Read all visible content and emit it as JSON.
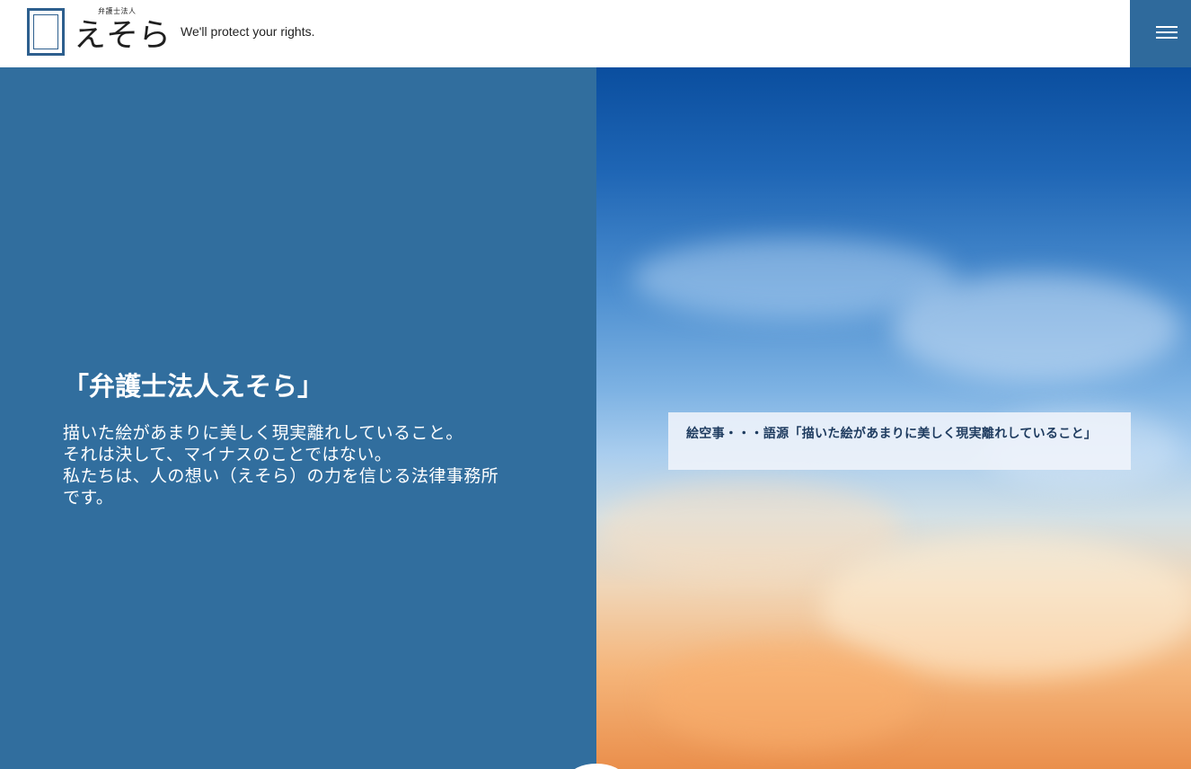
{
  "header": {
    "logo": {
      "small_text": "弁護士法人",
      "main_text": "えそら"
    },
    "tagline": "We'll protect your rights.",
    "menu_icon": "hamburger-menu-icon"
  },
  "hero": {
    "title": "「弁護士法人えそら」",
    "lines": [
      "描いた絵があまりに美しく現実離れしていること。",
      "それは決して、マイナスのことではない。",
      "私たちは、人の想い（えそら）の力を信じる法律事務所",
      "です。"
    ]
  },
  "image_caption": "絵空事・・・語源「描いた絵があまりに美しく現実離れしていること」",
  "colors": {
    "brand_blue": "#316e9e",
    "menu_bg": "#2f6a9c",
    "text_on_blue": "#ffffff"
  }
}
